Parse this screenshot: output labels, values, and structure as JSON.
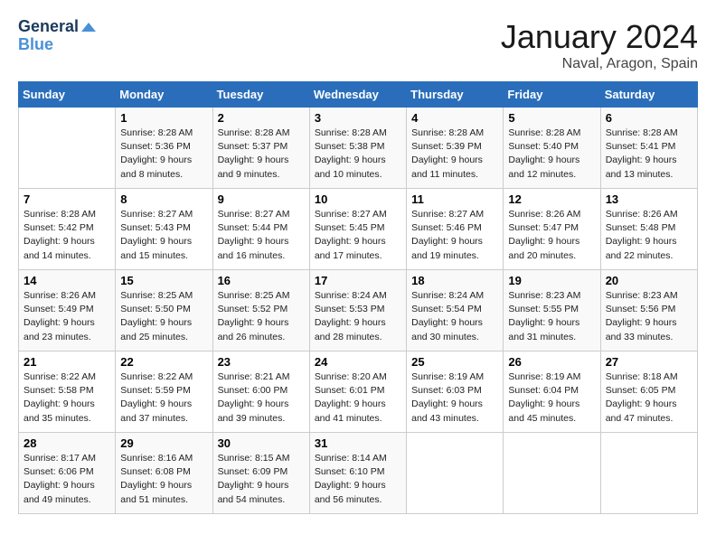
{
  "header": {
    "logo_line1": "General",
    "logo_line2": "Blue",
    "month": "January 2024",
    "location": "Naval, Aragon, Spain"
  },
  "days_of_week": [
    "Sunday",
    "Monday",
    "Tuesday",
    "Wednesday",
    "Thursday",
    "Friday",
    "Saturday"
  ],
  "weeks": [
    [
      {
        "day": "",
        "sunrise": "",
        "sunset": "",
        "daylight": ""
      },
      {
        "day": "1",
        "sunrise": "Sunrise: 8:28 AM",
        "sunset": "Sunset: 5:36 PM",
        "daylight": "Daylight: 9 hours and 8 minutes."
      },
      {
        "day": "2",
        "sunrise": "Sunrise: 8:28 AM",
        "sunset": "Sunset: 5:37 PM",
        "daylight": "Daylight: 9 hours and 9 minutes."
      },
      {
        "day": "3",
        "sunrise": "Sunrise: 8:28 AM",
        "sunset": "Sunset: 5:38 PM",
        "daylight": "Daylight: 9 hours and 10 minutes."
      },
      {
        "day": "4",
        "sunrise": "Sunrise: 8:28 AM",
        "sunset": "Sunset: 5:39 PM",
        "daylight": "Daylight: 9 hours and 11 minutes."
      },
      {
        "day": "5",
        "sunrise": "Sunrise: 8:28 AM",
        "sunset": "Sunset: 5:40 PM",
        "daylight": "Daylight: 9 hours and 12 minutes."
      },
      {
        "day": "6",
        "sunrise": "Sunrise: 8:28 AM",
        "sunset": "Sunset: 5:41 PM",
        "daylight": "Daylight: 9 hours and 13 minutes."
      }
    ],
    [
      {
        "day": "7",
        "sunrise": "Sunrise: 8:28 AM",
        "sunset": "Sunset: 5:42 PM",
        "daylight": "Daylight: 9 hours and 14 minutes."
      },
      {
        "day": "8",
        "sunrise": "Sunrise: 8:27 AM",
        "sunset": "Sunset: 5:43 PM",
        "daylight": "Daylight: 9 hours and 15 minutes."
      },
      {
        "day": "9",
        "sunrise": "Sunrise: 8:27 AM",
        "sunset": "Sunset: 5:44 PM",
        "daylight": "Daylight: 9 hours and 16 minutes."
      },
      {
        "day": "10",
        "sunrise": "Sunrise: 8:27 AM",
        "sunset": "Sunset: 5:45 PM",
        "daylight": "Daylight: 9 hours and 17 minutes."
      },
      {
        "day": "11",
        "sunrise": "Sunrise: 8:27 AM",
        "sunset": "Sunset: 5:46 PM",
        "daylight": "Daylight: 9 hours and 19 minutes."
      },
      {
        "day": "12",
        "sunrise": "Sunrise: 8:26 AM",
        "sunset": "Sunset: 5:47 PM",
        "daylight": "Daylight: 9 hours and 20 minutes."
      },
      {
        "day": "13",
        "sunrise": "Sunrise: 8:26 AM",
        "sunset": "Sunset: 5:48 PM",
        "daylight": "Daylight: 9 hours and 22 minutes."
      }
    ],
    [
      {
        "day": "14",
        "sunrise": "Sunrise: 8:26 AM",
        "sunset": "Sunset: 5:49 PM",
        "daylight": "Daylight: 9 hours and 23 minutes."
      },
      {
        "day": "15",
        "sunrise": "Sunrise: 8:25 AM",
        "sunset": "Sunset: 5:50 PM",
        "daylight": "Daylight: 9 hours and 25 minutes."
      },
      {
        "day": "16",
        "sunrise": "Sunrise: 8:25 AM",
        "sunset": "Sunset: 5:52 PM",
        "daylight": "Daylight: 9 hours and 26 minutes."
      },
      {
        "day": "17",
        "sunrise": "Sunrise: 8:24 AM",
        "sunset": "Sunset: 5:53 PM",
        "daylight": "Daylight: 9 hours and 28 minutes."
      },
      {
        "day": "18",
        "sunrise": "Sunrise: 8:24 AM",
        "sunset": "Sunset: 5:54 PM",
        "daylight": "Daylight: 9 hours and 30 minutes."
      },
      {
        "day": "19",
        "sunrise": "Sunrise: 8:23 AM",
        "sunset": "Sunset: 5:55 PM",
        "daylight": "Daylight: 9 hours and 31 minutes."
      },
      {
        "day": "20",
        "sunrise": "Sunrise: 8:23 AM",
        "sunset": "Sunset: 5:56 PM",
        "daylight": "Daylight: 9 hours and 33 minutes."
      }
    ],
    [
      {
        "day": "21",
        "sunrise": "Sunrise: 8:22 AM",
        "sunset": "Sunset: 5:58 PM",
        "daylight": "Daylight: 9 hours and 35 minutes."
      },
      {
        "day": "22",
        "sunrise": "Sunrise: 8:22 AM",
        "sunset": "Sunset: 5:59 PM",
        "daylight": "Daylight: 9 hours and 37 minutes."
      },
      {
        "day": "23",
        "sunrise": "Sunrise: 8:21 AM",
        "sunset": "Sunset: 6:00 PM",
        "daylight": "Daylight: 9 hours and 39 minutes."
      },
      {
        "day": "24",
        "sunrise": "Sunrise: 8:20 AM",
        "sunset": "Sunset: 6:01 PM",
        "daylight": "Daylight: 9 hours and 41 minutes."
      },
      {
        "day": "25",
        "sunrise": "Sunrise: 8:19 AM",
        "sunset": "Sunset: 6:03 PM",
        "daylight": "Daylight: 9 hours and 43 minutes."
      },
      {
        "day": "26",
        "sunrise": "Sunrise: 8:19 AM",
        "sunset": "Sunset: 6:04 PM",
        "daylight": "Daylight: 9 hours and 45 minutes."
      },
      {
        "day": "27",
        "sunrise": "Sunrise: 8:18 AM",
        "sunset": "Sunset: 6:05 PM",
        "daylight": "Daylight: 9 hours and 47 minutes."
      }
    ],
    [
      {
        "day": "28",
        "sunrise": "Sunrise: 8:17 AM",
        "sunset": "Sunset: 6:06 PM",
        "daylight": "Daylight: 9 hours and 49 minutes."
      },
      {
        "day": "29",
        "sunrise": "Sunrise: 8:16 AM",
        "sunset": "Sunset: 6:08 PM",
        "daylight": "Daylight: 9 hours and 51 minutes."
      },
      {
        "day": "30",
        "sunrise": "Sunrise: 8:15 AM",
        "sunset": "Sunset: 6:09 PM",
        "daylight": "Daylight: 9 hours and 54 minutes."
      },
      {
        "day": "31",
        "sunrise": "Sunrise: 8:14 AM",
        "sunset": "Sunset: 6:10 PM",
        "daylight": "Daylight: 9 hours and 56 minutes."
      },
      {
        "day": "",
        "sunrise": "",
        "sunset": "",
        "daylight": ""
      },
      {
        "day": "",
        "sunrise": "",
        "sunset": "",
        "daylight": ""
      },
      {
        "day": "",
        "sunrise": "",
        "sunset": "",
        "daylight": ""
      }
    ]
  ]
}
